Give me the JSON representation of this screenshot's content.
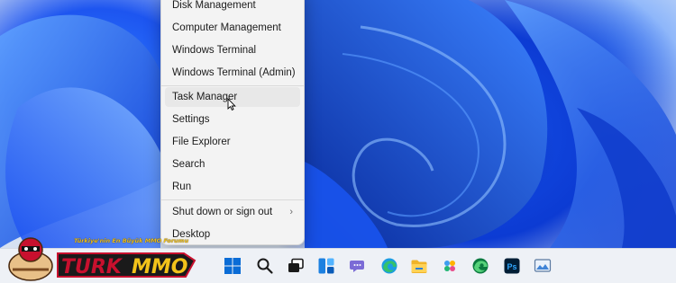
{
  "context_menu": {
    "items": [
      {
        "label": "Disk Management",
        "name": "menu-item-disk-management"
      },
      {
        "label": "Computer Management",
        "name": "menu-item-computer-management"
      },
      {
        "label": "Windows Terminal",
        "name": "menu-item-windows-terminal"
      },
      {
        "label": "Windows Terminal (Admin)",
        "name": "menu-item-windows-terminal-admin"
      },
      {
        "label": "Task Manager",
        "name": "menu-item-task-manager",
        "hovered": true
      },
      {
        "label": "Settings",
        "name": "menu-item-settings"
      },
      {
        "label": "File Explorer",
        "name": "menu-item-file-explorer"
      },
      {
        "label": "Search",
        "name": "menu-item-search"
      },
      {
        "label": "Run",
        "name": "menu-item-run"
      },
      {
        "label": "Shut down or sign out",
        "name": "menu-item-shut-down",
        "has_submenu": true
      },
      {
        "label": "Desktop",
        "name": "menu-item-desktop"
      }
    ],
    "submenu_glyph": "›"
  },
  "taskbar": {
    "icons": [
      {
        "name": "start-icon"
      },
      {
        "name": "search-icon"
      },
      {
        "name": "task-view-icon"
      },
      {
        "name": "widgets-icon"
      },
      {
        "name": "teams-chat-icon"
      },
      {
        "name": "edge-icon"
      },
      {
        "name": "file-explorer-icon"
      },
      {
        "name": "photos-icon"
      },
      {
        "name": "edge-beta-icon"
      },
      {
        "name": "photoshop-icon"
      },
      {
        "name": "photo-viewer-icon"
      }
    ],
    "photoshop_text": "Ps"
  },
  "watermark": {
    "tagline": "Türkiye'nin En Büyük MMO Forumu",
    "colors": {
      "primary": "#c8102e",
      "accent": "#f2c21a"
    }
  },
  "colors": {
    "menu_bg": "#f3f3f3",
    "menu_hover": "#e8e8e8",
    "taskbar_bg": "#eef1f6",
    "accent_blue": "#0067c0"
  }
}
